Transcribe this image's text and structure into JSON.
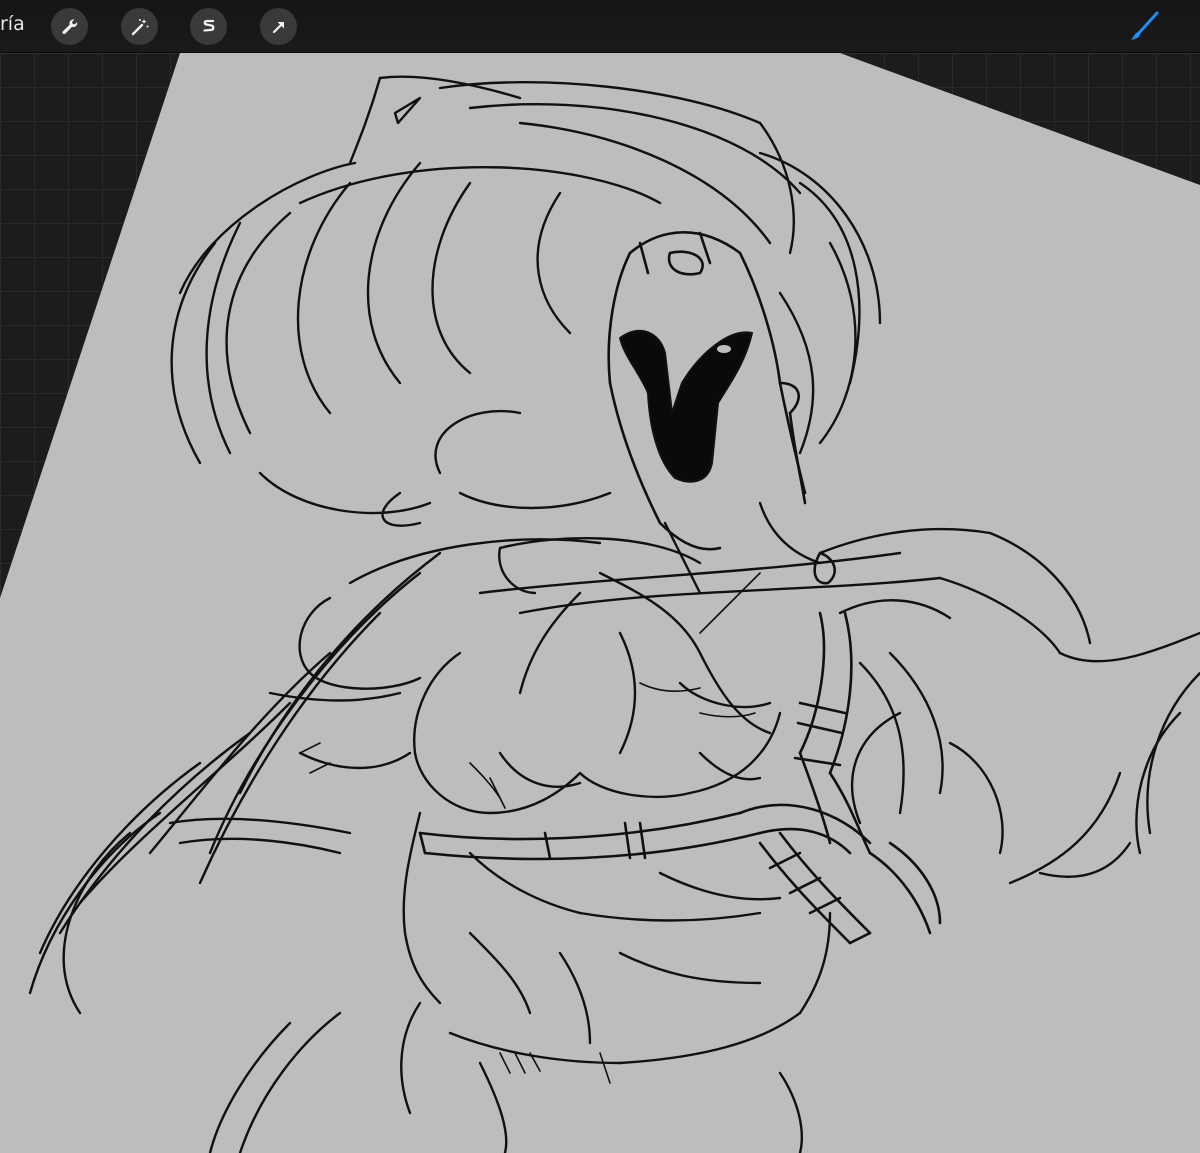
{
  "toolbar": {
    "gallery_label": "ría",
    "tools": [
      {
        "name": "adjustments-wrench",
        "icon": "wrench-icon"
      },
      {
        "name": "magic-wand",
        "icon": "magic-wand-icon"
      },
      {
        "name": "selection",
        "icon": "selection-s-icon"
      },
      {
        "name": "transform",
        "icon": "arrow-cursor-icon"
      }
    ],
    "active_tool_icon": "brush-icon",
    "accent_color": "#1f8ef1"
  },
  "canvas": {
    "paper_color": "#bdbdbd",
    "ink_color": "#111111",
    "workspace_color": "#1c1c1e"
  }
}
